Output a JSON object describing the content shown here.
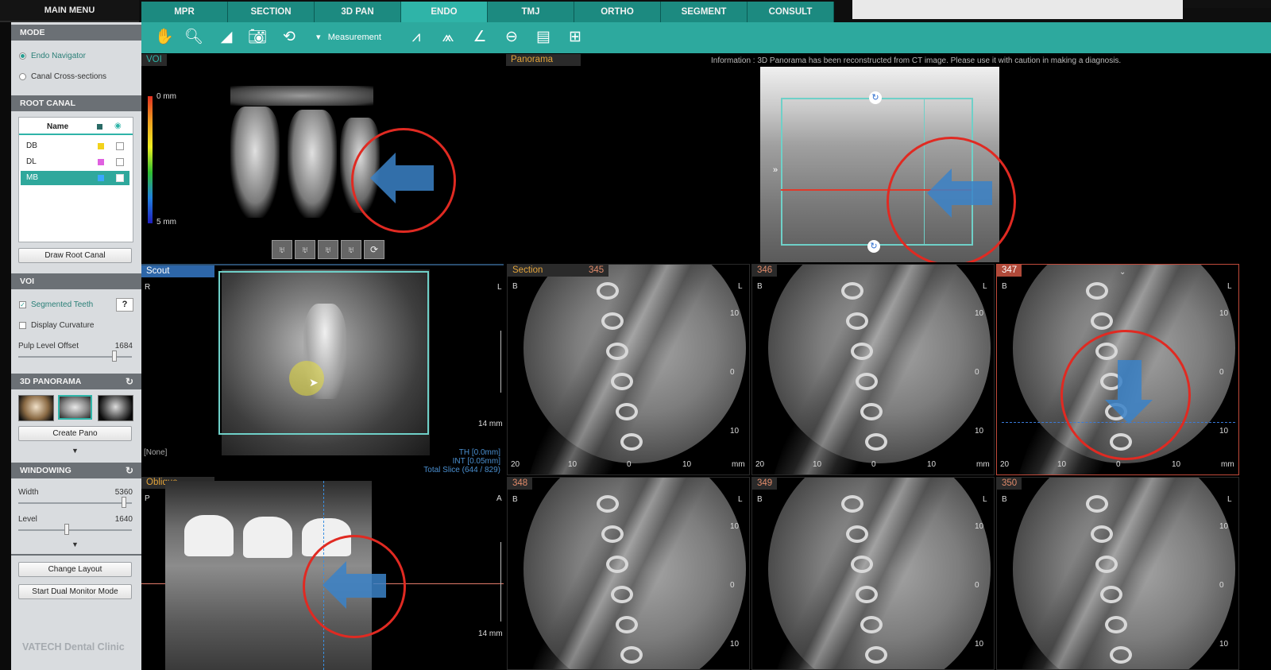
{
  "main_menu": "MAIN MENU",
  "tabs": [
    "MPR",
    "SECTION",
    "3D PAN",
    "ENDO",
    "TMJ",
    "ORTHO",
    "SEGMENT",
    "CONSULT"
  ],
  "active_tab": "ENDO",
  "toolbar": {
    "measurement_label": "Measurement"
  },
  "mode": {
    "header": "MODE",
    "options": [
      {
        "label": "Endo Navigator",
        "selected": true
      },
      {
        "label": "Canal Cross-sections",
        "selected": false
      }
    ]
  },
  "root_canal": {
    "header": "ROOT CANAL",
    "col_name": "Name",
    "rows": [
      {
        "name": "DB",
        "color": "#f2d21b"
      },
      {
        "name": "DL",
        "color": "#e060e0"
      },
      {
        "name": "MB",
        "color": "#3aa7ff"
      }
    ],
    "draw_button": "Draw Root Canal"
  },
  "voi": {
    "header": "VOI",
    "segmented_teeth": "Segmented Teeth",
    "help": "?",
    "display_curvature": "Display Curvature",
    "pulp_label": "Pulp Level Offset",
    "pulp_value": "1684",
    "pulp_level": 0.86
  },
  "panorama3d": {
    "header": "3D PANORAMA",
    "create_button": "Create Pano"
  },
  "windowing": {
    "header": "WINDOWING",
    "width_label": "Width",
    "width_value": "5360",
    "width_level": 0.95,
    "level_label": "Level",
    "level_value": "1640",
    "level_level": 0.42
  },
  "bottom_buttons": {
    "change_layout": "Change Layout",
    "dual_monitor": "Start Dual Monitor Mode"
  },
  "brand": "VATECH Dental Clinic",
  "views": {
    "voi": {
      "label": "VOI",
      "scale_top": "0 mm",
      "scale_bottom": "5 mm"
    },
    "panorama": {
      "label": "Panorama",
      "info": "Information : 3D Panorama has been reconstructed from CT image. Please use it with caution in making a diagnosis."
    },
    "scout": {
      "label": "Scout",
      "r": "R",
      "l": "L",
      "mm": "14 mm",
      "none": "[None]",
      "th": "TH [0.0mm]",
      "int": "INT [0.05mm]",
      "total": "Total Slice (644 / 829)"
    },
    "section": {
      "label": "Section"
    },
    "oblique": {
      "label": "Oblique",
      "p": "P",
      "a": "A",
      "mm": "14 mm"
    }
  },
  "slices": [
    {
      "num": "345",
      "b": "B",
      "l": "L",
      "ticks_y": [
        "10",
        "0",
        "10"
      ],
      "ticks_x": [
        "20",
        "10",
        "0",
        "10",
        "mm"
      ]
    },
    {
      "num": "346",
      "b": "B",
      "l": "L",
      "ticks_y": [
        "10",
        "0",
        "10"
      ],
      "ticks_x": [
        "20",
        "10",
        "0",
        "10",
        "mm"
      ]
    },
    {
      "num": "347",
      "b": "B",
      "l": "L",
      "ticks_y": [
        "10",
        "0",
        "10"
      ],
      "ticks_x": [
        "20",
        "10",
        "0",
        "10",
        "mm"
      ]
    },
    {
      "num": "348",
      "b": "B",
      "l": "L",
      "ticks_y": [
        "10",
        "0",
        "10"
      ],
      "ticks_x": []
    },
    {
      "num": "349",
      "b": "B",
      "l": "L",
      "ticks_y": [
        "10",
        "0",
        "10"
      ],
      "ticks_x": []
    },
    {
      "num": "350",
      "b": "B",
      "l": "L",
      "ticks_y": [
        "10",
        "0",
        "10"
      ],
      "ticks_x": []
    }
  ]
}
